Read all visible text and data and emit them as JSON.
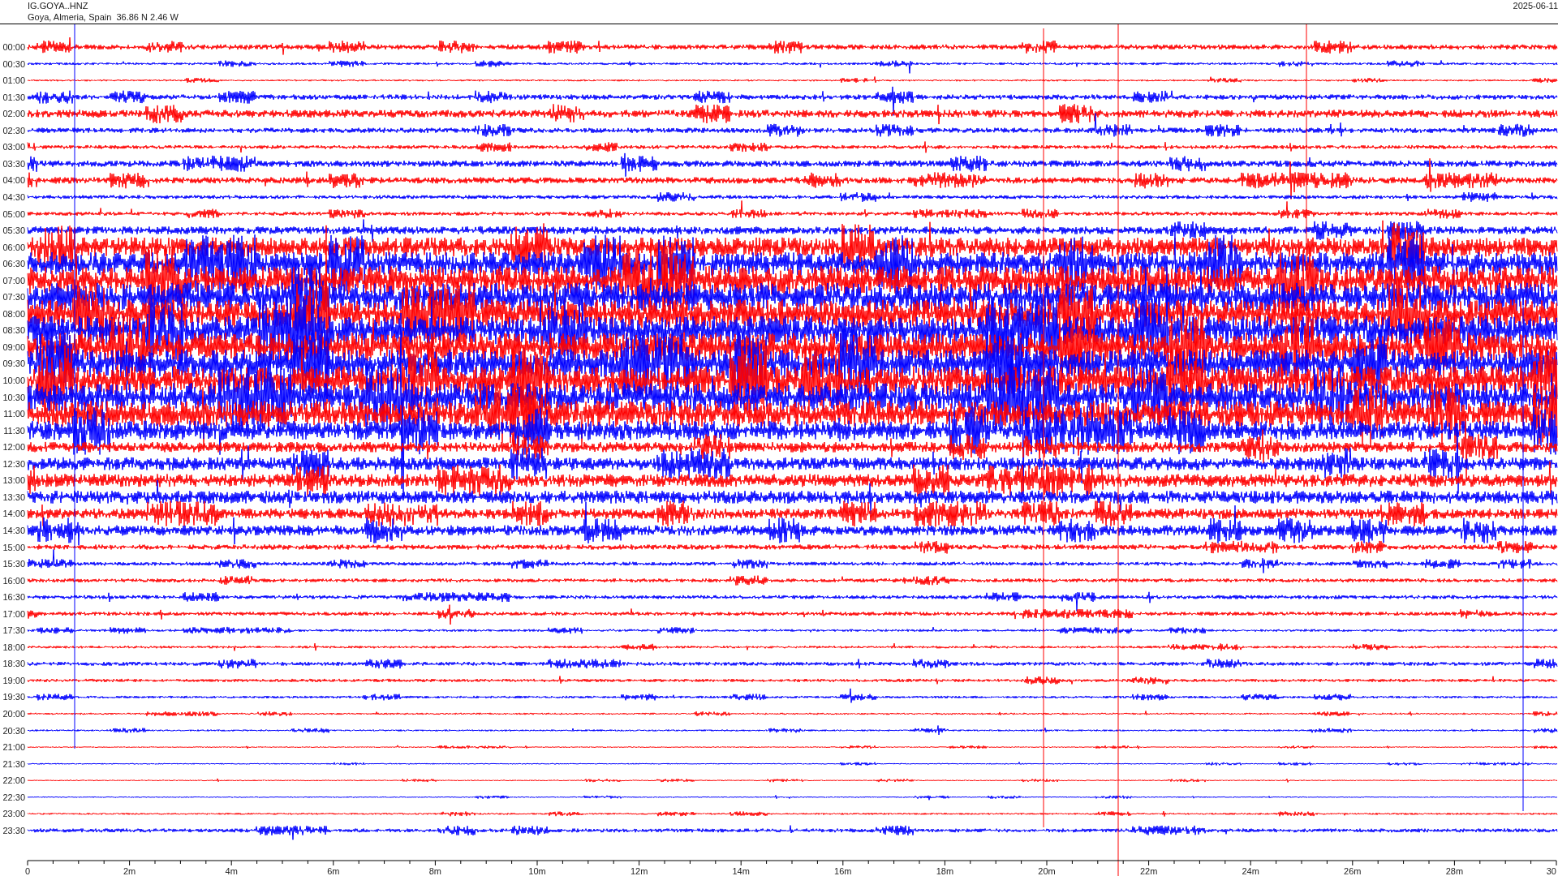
{
  "header": {
    "station": "IG.GOYA..HNZ",
    "location": "Goya, Almeria, Spain  36.86 N 2.46 W",
    "date": "2025-06-11"
  },
  "rows": [
    {
      "time": "00:00"
    },
    {
      "time": "00:30"
    },
    {
      "time": "01:00"
    },
    {
      "time": "01:30"
    },
    {
      "time": "02:00"
    },
    {
      "time": "02:30"
    },
    {
      "time": "03:00"
    },
    {
      "time": "03:30"
    },
    {
      "time": "04:00"
    },
    {
      "time": "04:30"
    },
    {
      "time": "05:00"
    },
    {
      "time": "05:30"
    },
    {
      "time": "06:00"
    },
    {
      "time": "06:30"
    },
    {
      "time": "07:00"
    },
    {
      "time": "07:30"
    },
    {
      "time": "08:00"
    },
    {
      "time": "08:30"
    },
    {
      "time": "09:00"
    },
    {
      "time": "09:30"
    },
    {
      "time": "10:00"
    },
    {
      "time": "10:30"
    },
    {
      "time": "11:00"
    },
    {
      "time": "11:30"
    },
    {
      "time": "12:00"
    },
    {
      "time": "12:30"
    },
    {
      "time": "13:00"
    },
    {
      "time": "13:30"
    },
    {
      "time": "14:00"
    },
    {
      "time": "14:30"
    },
    {
      "time": "15:00"
    },
    {
      "time": "15:30"
    },
    {
      "time": "16:00"
    },
    {
      "time": "16:30"
    },
    {
      "time": "17:00"
    },
    {
      "time": "17:30"
    },
    {
      "time": "18:00"
    },
    {
      "time": "18:30"
    },
    {
      "time": "19:00"
    },
    {
      "time": "19:30"
    },
    {
      "time": "20:00"
    },
    {
      "time": "20:30"
    },
    {
      "time": "21:00"
    },
    {
      "time": "21:30"
    },
    {
      "time": "22:00"
    },
    {
      "time": "22:30"
    },
    {
      "time": "23:00"
    },
    {
      "time": "23:30"
    }
  ],
  "x_axis": {
    "ticks": [
      "0",
      "2m",
      "4m",
      "6m",
      "8m",
      "10m",
      "12m",
      "14m",
      "16m",
      "18m",
      "20m",
      "22m",
      "24m",
      "26m",
      "28m",
      "30"
    ]
  }
}
